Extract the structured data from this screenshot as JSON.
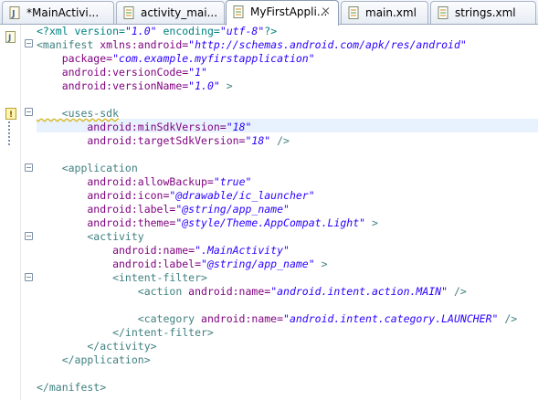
{
  "tabs": [
    {
      "label": "*MainActivi...",
      "icon": "java-file-icon",
      "active": false
    },
    {
      "label": "activity_mai...",
      "icon": "xml-file-icon",
      "active": false
    },
    {
      "label": "MyFirstAppli...",
      "icon": "xml-file-icon",
      "active": true,
      "close": "⨯"
    },
    {
      "label": "main.xml",
      "icon": "xml-file-icon",
      "active": false
    },
    {
      "label": "strings.xml",
      "icon": "xml-file-icon",
      "active": false
    }
  ],
  "code": {
    "l1": {
      "a": "<?xml version=",
      "b": "\"1.0\"",
      "c": " encoding=",
      "d": "\"utf-8\"",
      "e": "?>"
    },
    "l2": {
      "a": "<manifest",
      "b": " xmlns:android=",
      "c": "\"http://schemas.android.com/apk/res/android\""
    },
    "l3": {
      "a": "    package=",
      "b": "\"com.example.myfirstapplication\""
    },
    "l4": {
      "a": "    android:versionCode=",
      "b": "\"1\""
    },
    "l5": {
      "a": "    android:versionName=",
      "b": "\"1.0\"",
      "c": " >"
    },
    "l7": {
      "a": "    <uses-sdk"
    },
    "l8": {
      "a": "        android:minSdkVersion=",
      "b": "\"18\""
    },
    "l9": {
      "a": "        android:targetSdkVersion=",
      "b": "\"18\"",
      "c": " />"
    },
    "l11": {
      "a": "    <application"
    },
    "l12": {
      "a": "        android:allowBackup=",
      "b": "\"true\""
    },
    "l13": {
      "a": "        android:icon=",
      "b": "\"@drawable/ic_launcher\""
    },
    "l14": {
      "a": "        android:label=",
      "b": "\"@string/app_name\""
    },
    "l15": {
      "a": "        android:theme=",
      "b": "\"@style/Theme.AppCompat.Light\"",
      "c": " >"
    },
    "l16": {
      "a": "        <activity"
    },
    "l17": {
      "a": "            android:name=",
      "b": "\".MainActivity\""
    },
    "l18": {
      "a": "            android:label=",
      "b": "\"@string/app_name\"",
      "c": " >"
    },
    "l19": {
      "a": "            <intent-filter>"
    },
    "l20": {
      "a": "                <action",
      "b": " android:name=",
      "c": "\"android.intent.action.MAIN\"",
      "d": " />"
    },
    "l22": {
      "a": "                <category",
      "b": " android:name=",
      "c": "\"android.intent.category.LAUNCHER\"",
      "d": " />"
    },
    "l23": {
      "a": "            </intent-filter>"
    },
    "l24": {
      "a": "        </activity>"
    },
    "l25": {
      "a": "    </application>"
    },
    "l27": {
      "a": "</manifest>"
    }
  }
}
